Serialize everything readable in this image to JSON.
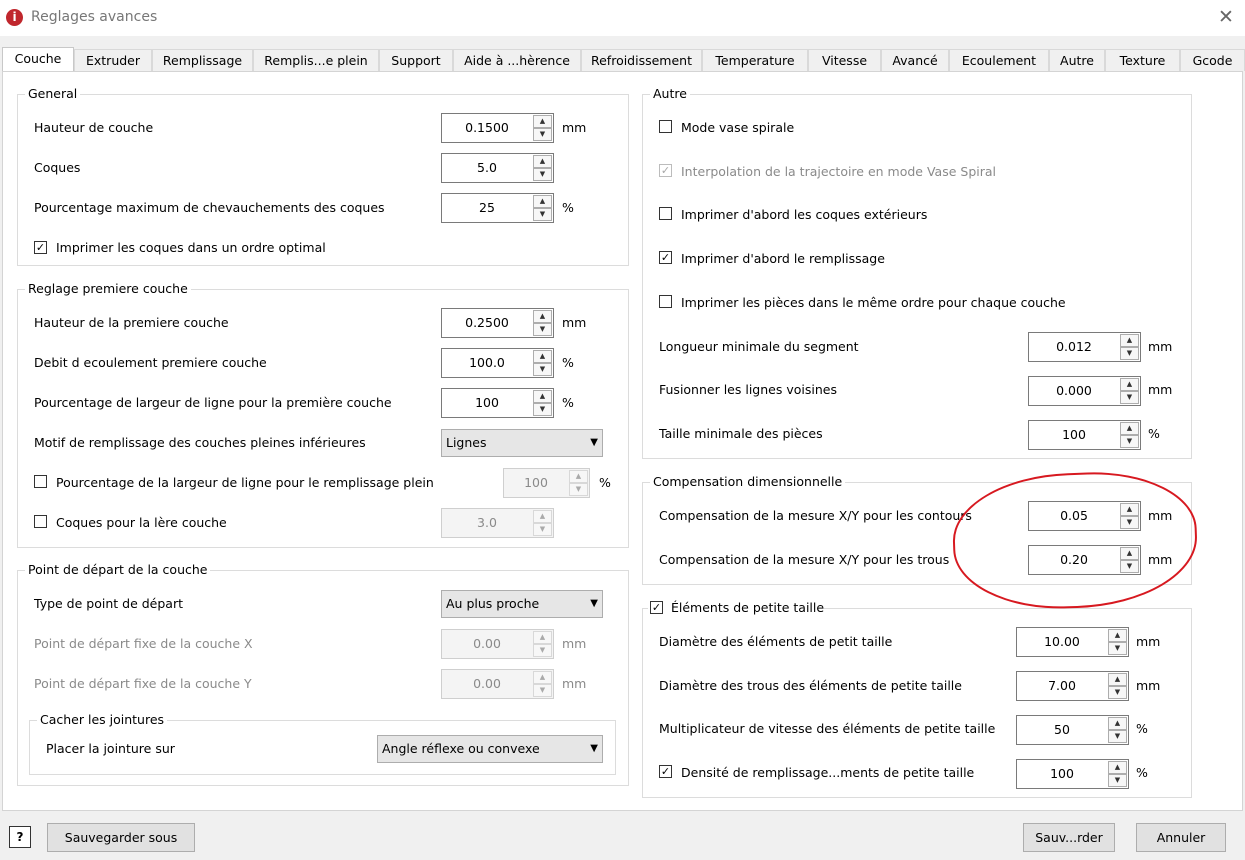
{
  "window": {
    "title": "Reglages avances"
  },
  "tabs": [
    "Couche",
    "Extruder",
    "Remplissage",
    "Remplis...e plein",
    "Support",
    "Aide à ...hèrence",
    "Refroidissement",
    "Temperature",
    "Vitesse",
    "Avancé",
    "Ecoulement",
    "Autre",
    "Texture",
    "Gcode"
  ],
  "general": {
    "title": "General",
    "layer_height": {
      "label": "Hauteur de couche",
      "value": "0.1500",
      "unit": "mm"
    },
    "shells": {
      "label": "Coques",
      "value": "5.0"
    },
    "overlap": {
      "label": "Pourcentage maximum de chevauchements des coques",
      "value": "25",
      "unit": "%"
    },
    "optimal_order": {
      "label": "Imprimer les coques dans un ordre optimal",
      "checked": true
    }
  },
  "first_layer": {
    "title": "Reglage premiere couche",
    "height": {
      "label": "Hauteur de la premiere couche",
      "value": "0.2500",
      "unit": "mm"
    },
    "flow": {
      "label": "Debit d ecoulement premiere couche",
      "value": "100.0",
      "unit": "%"
    },
    "line_width": {
      "label": "Pourcentage de largeur de ligne pour la première couche",
      "value": "100",
      "unit": "%"
    },
    "pattern": {
      "label": "Motif de remplissage des couches pleines inférieures",
      "value": "Lignes"
    },
    "solid_width": {
      "label": "Pourcentage de la largeur de ligne pour le remplissage plein",
      "value": "100",
      "unit": "%",
      "checked": false
    },
    "shells": {
      "label": "Coques pour la lère couche",
      "value": "3.0",
      "checked": false
    }
  },
  "start_point": {
    "title": "Point de départ de la couche",
    "type": {
      "label": "Type de point de départ",
      "value": "Au plus proche"
    },
    "x": {
      "label": "Point de départ fixe de la couche X",
      "value": "0.00",
      "unit": "mm"
    },
    "y": {
      "label": "Point de départ fixe de la couche Y",
      "value": "0.00",
      "unit": "mm"
    },
    "seam": {
      "title": "Cacher les jointures",
      "label": "Placer la jointure sur",
      "value": "Angle réflexe ou convexe"
    }
  },
  "other": {
    "title": "Autre",
    "vase": {
      "label": "Mode vase spirale",
      "checked": false
    },
    "interp": {
      "label": "Interpolation de la trajectoire en mode Vase Spiral",
      "checked": true
    },
    "outer_first": {
      "label": "Imprimer d'abord les coques extérieurs",
      "checked": false
    },
    "infill_first": {
      "label": "Imprimer d'abord le remplissage",
      "checked": true
    },
    "same_order": {
      "label": "Imprimer les pièces dans le même ordre pour chaque couche",
      "checked": false
    },
    "min_segment": {
      "label": "Longueur minimale du segment",
      "value": "0.012",
      "unit": "mm"
    },
    "merge_lines": {
      "label": "Fusionner les lignes voisines",
      "value": "0.000",
      "unit": "mm"
    },
    "min_part": {
      "label": "Taille minimale des pièces",
      "value": "100",
      "unit": "%"
    }
  },
  "dimensional": {
    "title": "Compensation dimensionnelle",
    "contours": {
      "label": "Compensation de la mesure X/Y pour les contours",
      "value": "0.05",
      "unit": "mm"
    },
    "holes": {
      "label": "Compensation de la mesure X/Y pour les trous",
      "value": "0.20",
      "unit": "mm"
    }
  },
  "small": {
    "title": "Éléments de petite taille",
    "checked": true,
    "diameter": {
      "label": "Diamètre des éléments de petit taille",
      "value": "10.00",
      "unit": "mm"
    },
    "hole_diameter": {
      "label": "Diamètre des trous des éléments de petite taille",
      "value": "7.00",
      "unit": "mm"
    },
    "speed": {
      "label": "Multiplicateur de vitesse des éléments de petite taille",
      "value": "50",
      "unit": "%"
    },
    "density": {
      "label": "Densité de remplissage...ments de petite taille",
      "value": "100",
      "unit": "%",
      "checked": true
    }
  },
  "footer": {
    "help": "?",
    "save_as": "Sauvegarder sous",
    "save": "Sauv...rder",
    "cancel": "Annuler"
  },
  "colors": {
    "annotation": "#d71920"
  }
}
